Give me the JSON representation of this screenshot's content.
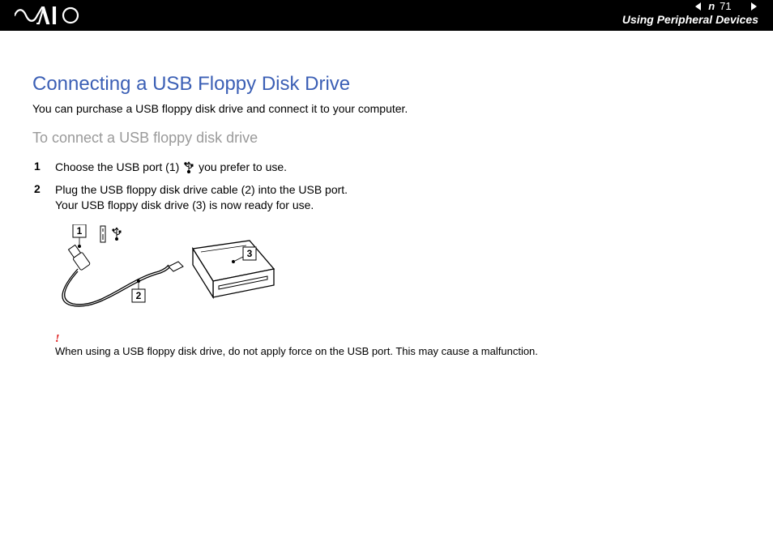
{
  "header": {
    "page_number": "71",
    "n_overlay": "n",
    "section": "Using Peripheral Devices"
  },
  "title": "Connecting a USB Floppy Disk Drive",
  "lead": "You can purchase a USB floppy disk drive and connect it to your computer.",
  "subtitle": "To connect a USB floppy disk drive",
  "steps": [
    {
      "num": "1",
      "pre": "Choose the USB port (1) ",
      "post": " you prefer to use.",
      "has_usb_icon": true
    },
    {
      "num": "2",
      "pre": "Plug the USB floppy disk drive cable (2) into the USB port.\nYour USB floppy disk drive (3) is now ready for use.",
      "post": "",
      "has_usb_icon": false
    }
  ],
  "illustration": {
    "labels": {
      "l1": "1",
      "l2": "2",
      "l3": "3"
    }
  },
  "warning": {
    "mark": "!",
    "text": "When using a USB floppy disk drive, do not apply force on the USB port. This may cause a malfunction."
  }
}
